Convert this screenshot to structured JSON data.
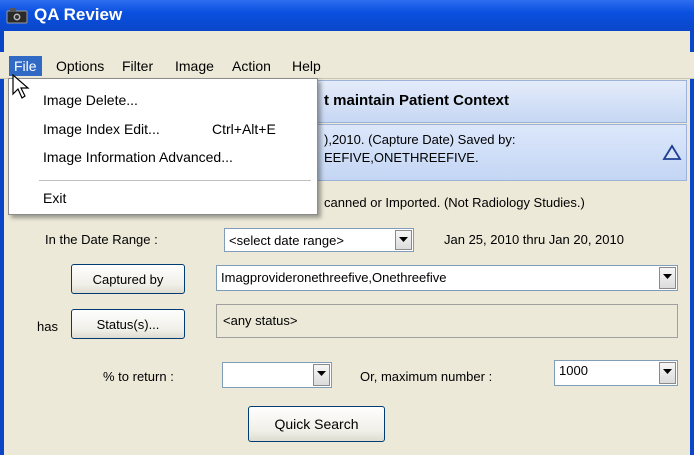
{
  "window": {
    "title": "QA Review",
    "icon": "camera-icon",
    "title_color": "#0a46c8"
  },
  "menu": {
    "items": [
      {
        "label": "File",
        "active": true
      },
      {
        "label": "Options"
      },
      {
        "label": "Filter"
      },
      {
        "label": "Image"
      },
      {
        "label": "Action"
      },
      {
        "label": "Help"
      }
    ],
    "file_dropdown": [
      {
        "label": "Image Delete...",
        "shortcut": ""
      },
      {
        "label": "Image Index Edit...",
        "shortcut": "Ctrl+Alt+E"
      },
      {
        "label": "Image Information Advanced...",
        "shortcut": ""
      },
      {
        "label": "Exit",
        "shortcut": ""
      }
    ]
  },
  "header": {
    "context_text": "t maintain Patient Context",
    "capture_line1": "),2010. (Capture Date) Saved by:",
    "capture_line2": "EEFIVE,ONETHREEFIVE.",
    "collapse_icon": "triangle-up-icon"
  },
  "info_line": "canned or Imported.  (Not Radiology Studies.)",
  "form": {
    "date_range_label": "In the Date Range :",
    "date_range_value": "<select date range>",
    "date_range_text": "Jan 25, 2010  thru  Jan 20, 2010",
    "captured_by_button": "Captured by",
    "captured_by_value": "Imagprovideronethreefive,Onethreefive",
    "has_label": "has",
    "status_button": "Status(s)...",
    "status_value": "<any status>",
    "percent_label": "% to return :",
    "percent_value": "",
    "max_label": "Or,  maximum number :",
    "max_value": "1000",
    "quick_search_button": "Quick Search"
  }
}
